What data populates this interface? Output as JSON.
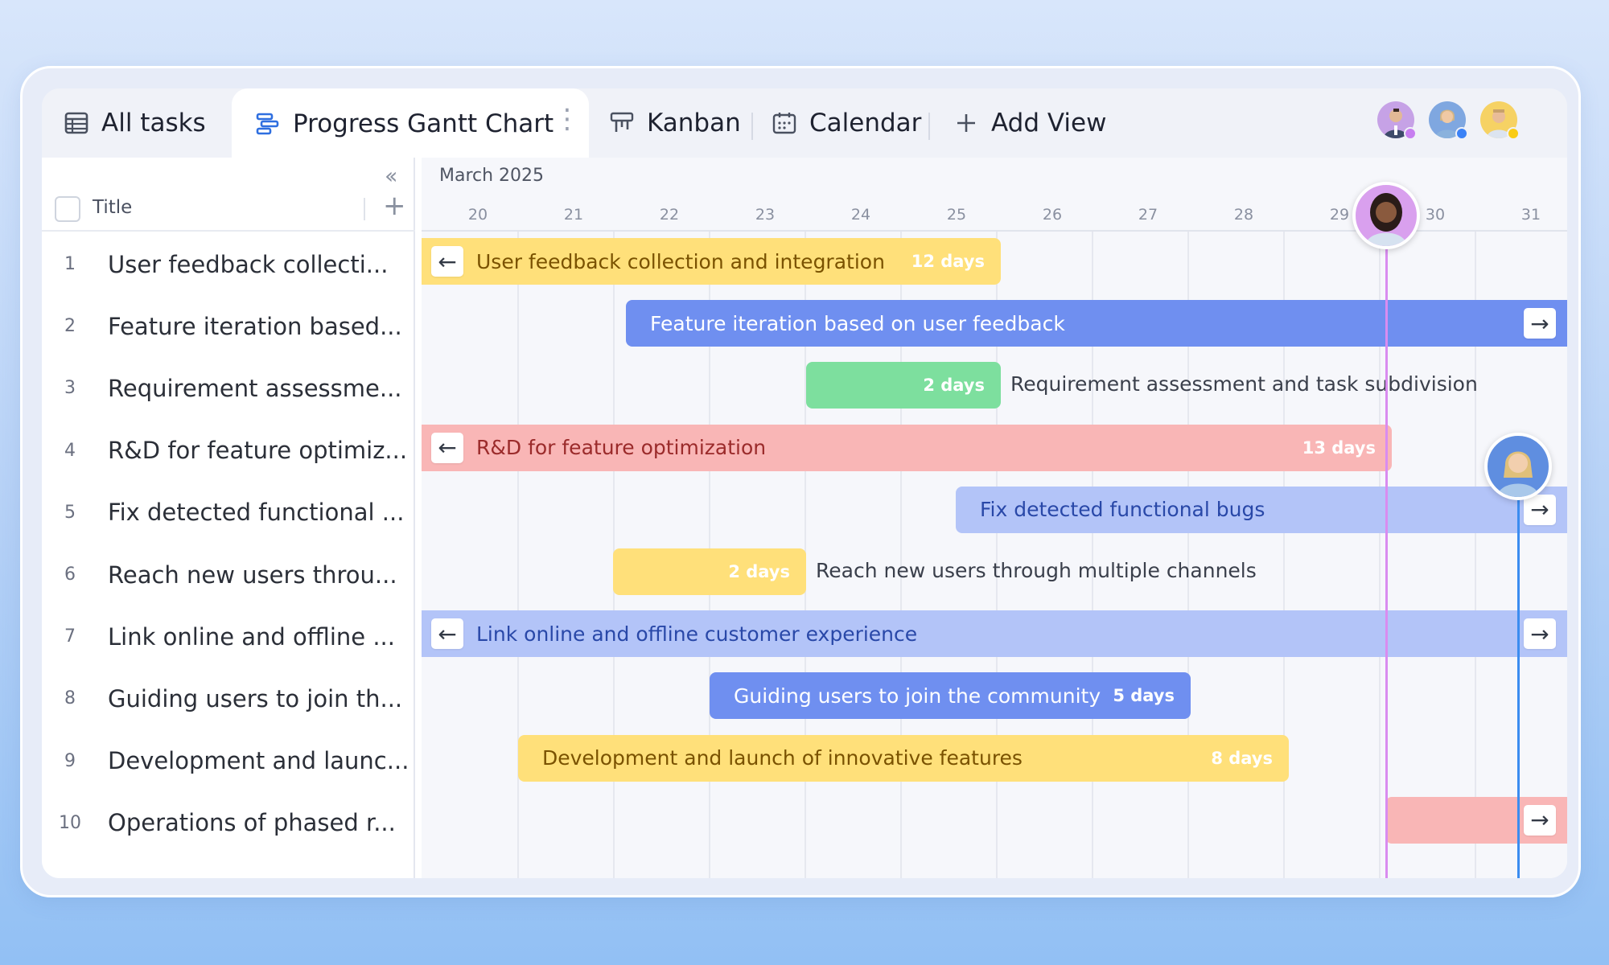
{
  "tabs": [
    {
      "label": "All tasks",
      "icon": "table-icon"
    },
    {
      "label": "Progress Gantt Chart",
      "icon": "gantt-icon"
    },
    {
      "label": "Kanban",
      "icon": "kanban-icon"
    },
    {
      "label": "Calendar",
      "icon": "calendar-icon"
    },
    {
      "label": "Add View",
      "icon": "plus-icon"
    }
  ],
  "collaborators": [
    {
      "name": "avatar-1",
      "status_color": "#c77ff0"
    },
    {
      "name": "avatar-2",
      "status_color": "#3b82f6"
    },
    {
      "name": "avatar-3",
      "status_color": "#facc15"
    }
  ],
  "list": {
    "column_title": "Title",
    "rows": [
      {
        "num": "1",
        "title": "User feedback collecti..."
      },
      {
        "num": "2",
        "title": "Feature iteration based..."
      },
      {
        "num": "3",
        "title": "Requirement assessme..."
      },
      {
        "num": "4",
        "title": "R&D for feature optimiz..."
      },
      {
        "num": "5",
        "title": "Fix detected functional ..."
      },
      {
        "num": "6",
        "title": "Reach new users throu..."
      },
      {
        "num": "7",
        "title": "Link online and offline ..."
      },
      {
        "num": "8",
        "title": "Guiding users to join th..."
      },
      {
        "num": "9",
        "title": "Development and launc..."
      },
      {
        "num": "10",
        "title": "Operations of phased r..."
      }
    ]
  },
  "gantt": {
    "month": "March 2025",
    "days": [
      "20",
      "21",
      "22",
      "23",
      "24",
      "25",
      "26",
      "27",
      "28",
      "29",
      "30",
      "31"
    ],
    "bars": [
      {
        "label": "User feedback collection and integration",
        "duration": "12 days"
      },
      {
        "label": "Feature iteration based on user feedback",
        "duration": ""
      },
      {
        "label": "Requirement assessment and task subdivision",
        "duration": "2 days"
      },
      {
        "label": "R&D for feature optimization",
        "duration": "13 days"
      },
      {
        "label": "Fix detected functional bugs",
        "duration": ""
      },
      {
        "label": "Reach new users through multiple channels",
        "duration": "2 days"
      },
      {
        "label": "Link online and offline customer experience",
        "duration": ""
      },
      {
        "label": "Guiding users to join the community",
        "duration": "5 days"
      },
      {
        "label": "Development and launch of innovative features",
        "duration": "8 days"
      },
      {
        "label": "",
        "duration": ""
      }
    ],
    "colors": {
      "yellow": "#ffe07a",
      "blue": "#6f8ff0",
      "green": "#7ddf9e",
      "pink": "#f9b6b6",
      "lightblue": "#b3c4f8",
      "marker_pink": "#d98cf0",
      "marker_blue": "#3b8cf0"
    }
  }
}
